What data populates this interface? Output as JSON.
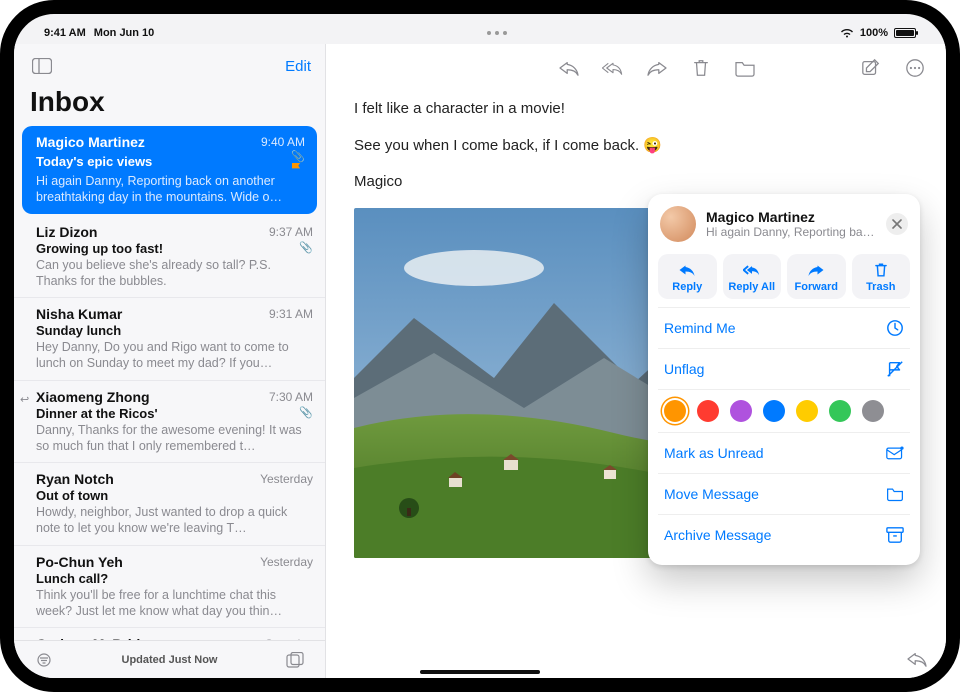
{
  "status": {
    "time": "9:41 AM",
    "date": "Mon Jun 10",
    "battery": "100%"
  },
  "sidebar": {
    "edit": "Edit",
    "title": "Inbox",
    "footer": "Updated Just Now",
    "messages": [
      {
        "sender": "Magico Martinez",
        "time": "9:40 AM",
        "subject": "Today's epic views",
        "preview": "Hi again Danny, Reporting back on another breathtaking day in the mountains. Wide o…",
        "selected": true,
        "attach": true,
        "flagged": true
      },
      {
        "sender": "Liz Dizon",
        "time": "9:37 AM",
        "subject": "Growing up too fast!",
        "preview": "Can you believe she's already so tall? P.S. Thanks for the bubbles.",
        "attach": true
      },
      {
        "sender": "Nisha Kumar",
        "time": "9:31 AM",
        "subject": "Sunday lunch",
        "preview": "Hey Danny, Do you and Rigo want to come to lunch on Sunday to meet my dad? If you…"
      },
      {
        "sender": "Xiaomeng Zhong",
        "time": "7:30 AM",
        "subject": "Dinner at the Ricos'",
        "preview": "Danny, Thanks for the awesome evening! It was so much fun that I only remembered t…",
        "attach": true,
        "replied": true
      },
      {
        "sender": "Ryan Notch",
        "time": "Yesterday",
        "subject": "Out of town",
        "preview": "Howdy, neighbor, Just wanted to drop a quick note to let you know we're leaving T…"
      },
      {
        "sender": "Po-Chun Yeh",
        "time": "Yesterday",
        "subject": "Lunch call?",
        "preview": "Think you'll be free for a lunchtime chat this week? Just let me know what day you thin…"
      },
      {
        "sender": "Graham McBride",
        "time": "Saturday",
        "subject": "",
        "preview": ""
      }
    ]
  },
  "message": {
    "line1": "I felt like a character in a movie!",
    "line2": "See you when I come back, if I come back. 😜",
    "signoff": "Magico"
  },
  "popover": {
    "name": "Magico Martinez",
    "preview": "Hi again Danny, Reporting back o…",
    "actions": {
      "reply": "Reply",
      "replyAll": "Reply All",
      "forward": "Forward",
      "trash": "Trash"
    },
    "remind": "Remind Me",
    "unflag": "Unflag",
    "colors": [
      "#ff9500",
      "#ff3b30",
      "#af52de",
      "#007aff",
      "#ffcc00",
      "#34c759",
      "#8e8e93"
    ],
    "markUnread": "Mark as Unread",
    "move": "Move Message",
    "archive": "Archive Message"
  }
}
